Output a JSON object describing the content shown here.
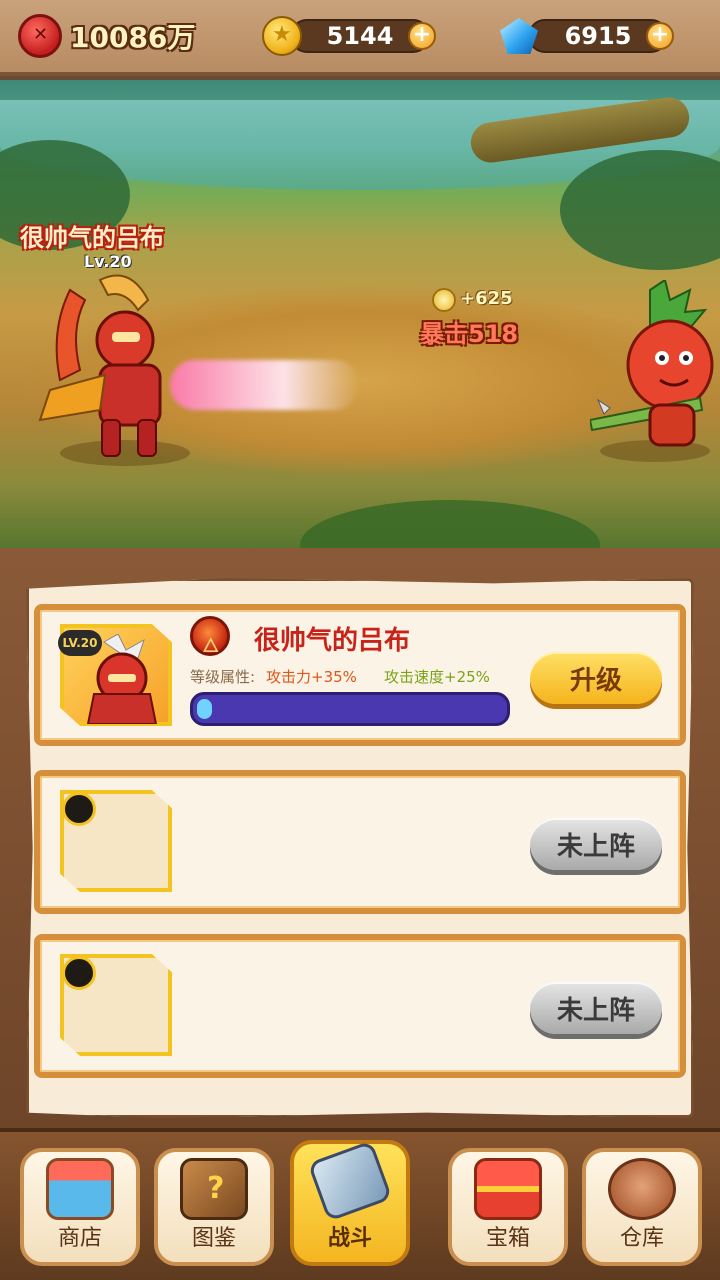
{
  "resources": {
    "power": "10086万",
    "gold": "5144",
    "gems": "6915",
    "add_symbol": "+"
  },
  "battle": {
    "hero_name": "很帅气的吕布",
    "hero_level": "Lv.20",
    "coin_gain": "+625",
    "crit_text": "暴击518"
  },
  "slots": [
    {
      "level_badge": "LV.20",
      "name": "很帅气的吕布",
      "attr_label": "等级属性:",
      "attr_attack": "攻击力+35%",
      "attr_speed": "攻击速度+25%",
      "progress": 0.05,
      "button": "升级"
    },
    {
      "button": "未上阵"
    },
    {
      "button": "未上阵"
    }
  ],
  "nav": {
    "items": [
      {
        "label": "商店",
        "icon": "shop-icon"
      },
      {
        "label": "图鉴",
        "icon": "book-icon"
      },
      {
        "label": "战斗",
        "icon": "hammer-icon",
        "active": true
      },
      {
        "label": "宝箱",
        "icon": "chest-icon"
      },
      {
        "label": "仓库",
        "icon": "storage-icon"
      }
    ]
  },
  "colors": {
    "accent_gold": "#f5b41c",
    "hero_name_red": "#c8231a",
    "progress_track": "#4a38b0",
    "progress_fill": "#6fd2ff"
  }
}
